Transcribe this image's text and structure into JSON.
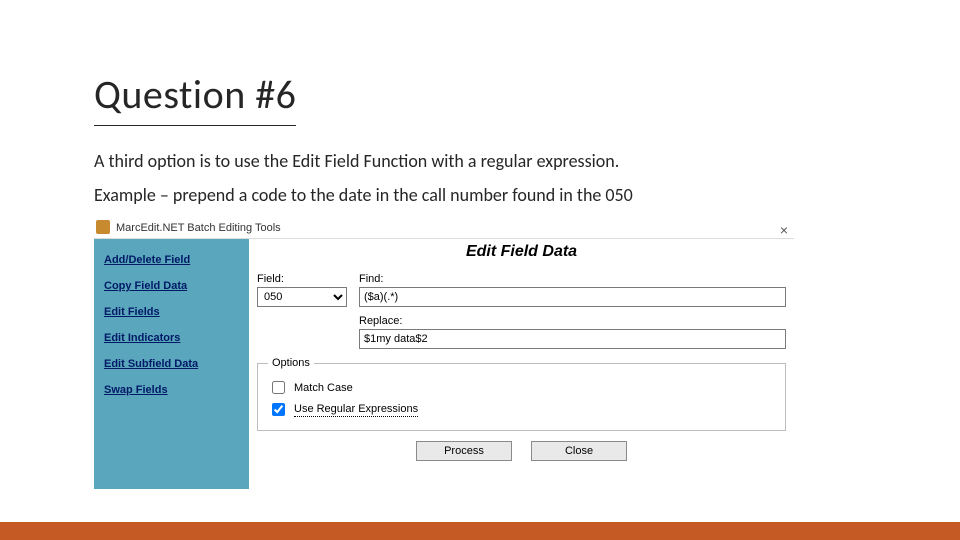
{
  "slide": {
    "title": "Question #6",
    "line1": "A third option is to use the Edit Field Function with a regular expression.",
    "line2": "Example – prepend a code to the date in the call number found in the 050"
  },
  "app": {
    "window_title": "MarcEdit.NET Batch Editing Tools",
    "close": "×",
    "panel_title": "Edit Field Data",
    "sidebar": {
      "items": [
        "Add/Delete Field",
        "Copy Field Data",
        "Edit Fields",
        "Edit Indicators",
        "Edit Subfield Data",
        "Swap Fields"
      ]
    },
    "labels": {
      "field": "Field:",
      "find": "Find:",
      "replace": "Replace:",
      "options": "Options",
      "match_case": "Match Case",
      "use_regex": "Use Regular Expressions"
    },
    "values": {
      "field": "050",
      "find": "($a)(.*)",
      "replace": "$1my data$2"
    },
    "buttons": {
      "process": "Process",
      "close": "Close"
    },
    "state": {
      "match_case_checked": false,
      "use_regex_checked": true
    }
  }
}
